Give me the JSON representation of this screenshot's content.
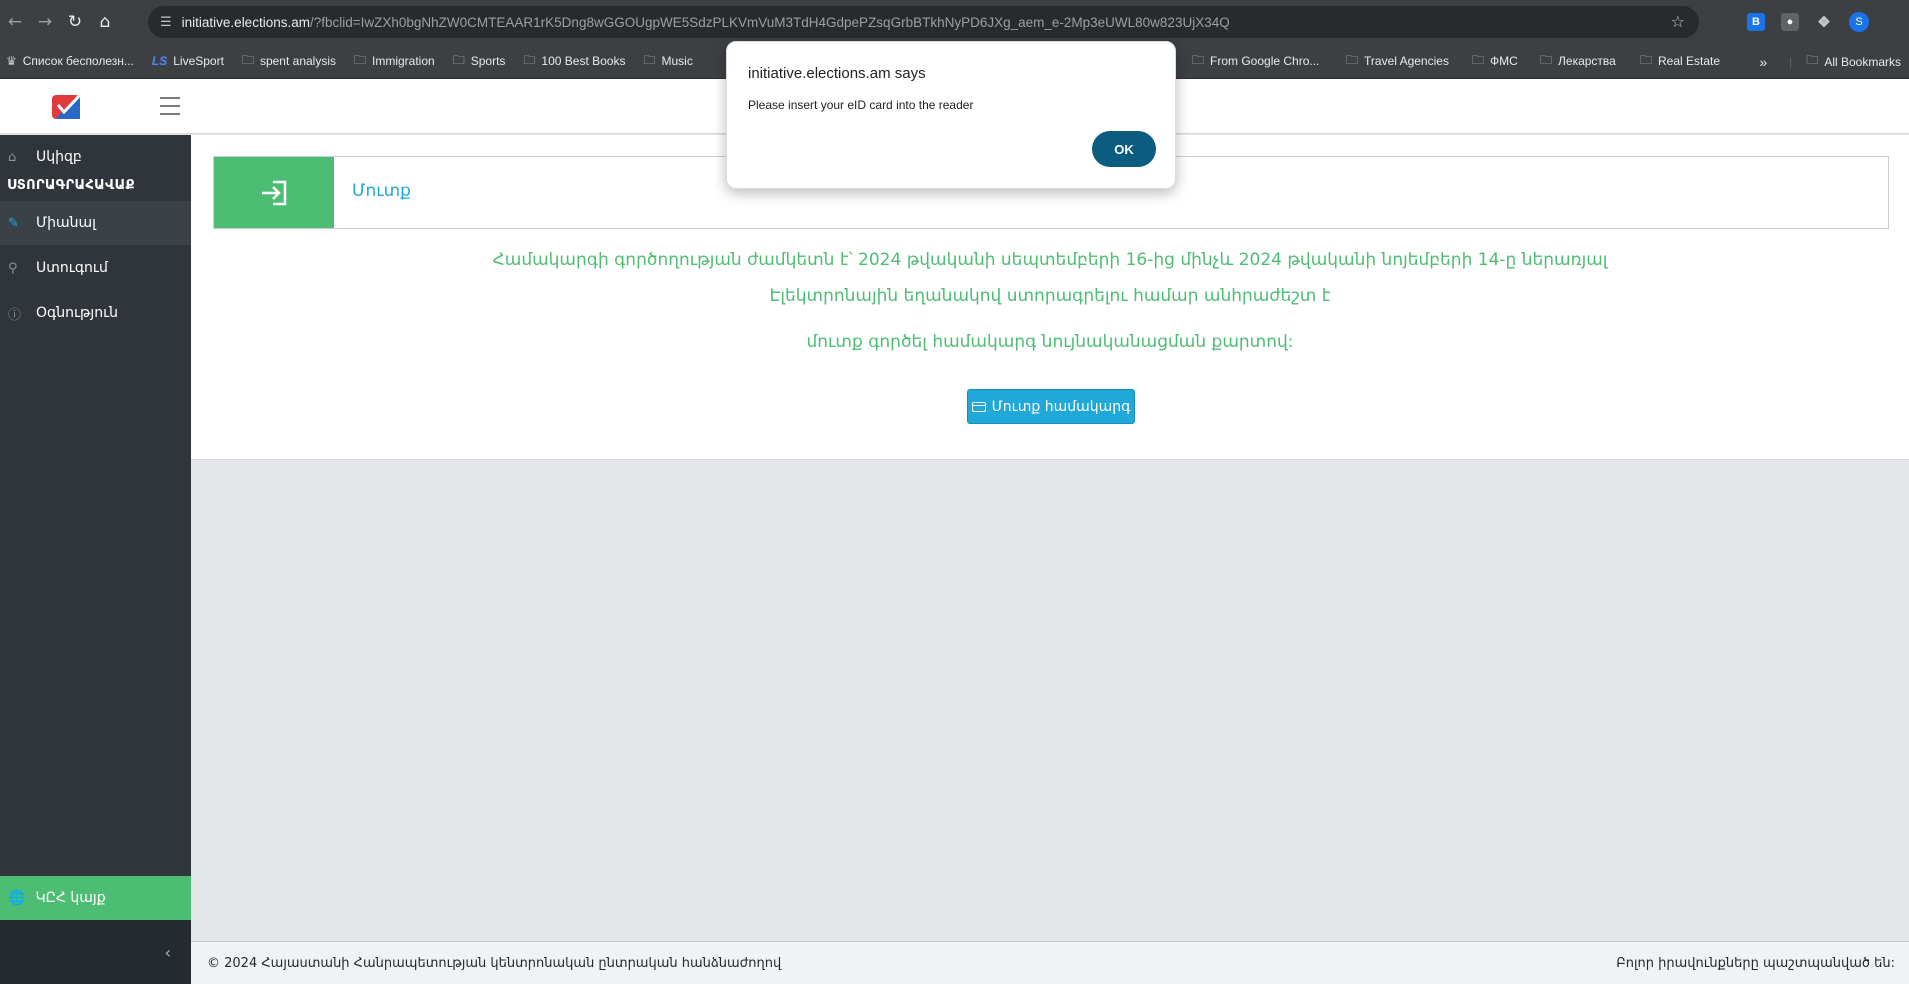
{
  "browser": {
    "url_host": "initiative.elections.am",
    "url_rest": "/?fbclid=IwZXh0bgNhZW0CMTEAAR1rK5Dng8wGGOUgpWE5SdzPLKVmVuM3TdH4GdpePZsqGrbBTkhNyPD6JXg_aem_e-2Mp3eUWL80w823UjX34Q",
    "profile_initial": "S",
    "ext_b_label": "B",
    "bookmarks": [
      {
        "label": "Список бесполезн...",
        "icon": "site-icon"
      },
      {
        "label": "LiveSport",
        "icon": "livesport-icon"
      },
      {
        "label": "spent analysis",
        "icon": "folder-icon"
      },
      {
        "label": "Immigration",
        "icon": "folder-icon"
      },
      {
        "label": "Sports",
        "icon": "folder-icon"
      },
      {
        "label": "100 Best Books",
        "icon": "folder-icon"
      },
      {
        "label": "Music",
        "icon": "folder-icon"
      }
    ],
    "bookmarks_right": [
      {
        "label": "From Google Chro...",
        "icon": "folder-icon"
      },
      {
        "label": "Travel Agencies",
        "icon": "folder-icon"
      },
      {
        "label": "ФМС",
        "icon": "folder-icon"
      },
      {
        "label": "Лекарства",
        "icon": "folder-icon"
      },
      {
        "label": "Real Estate",
        "icon": "folder-icon"
      }
    ],
    "more_label": "»",
    "all_bookmarks": "All Bookmarks"
  },
  "sidebar": {
    "items": [
      {
        "label": "Սկիզբ",
        "icon": "home-icon"
      },
      {
        "label": "Միանալ",
        "icon": "edit-icon"
      },
      {
        "label": "Ստուգում",
        "icon": "key-icon"
      },
      {
        "label": "Օգնություն",
        "icon": "info-icon"
      }
    ],
    "section_title": "ՍՏՈՐԱԳՐԱՀԱՎԱՔ",
    "bottom_link": "ԿԸՀ կայք"
  },
  "main": {
    "login_card_label": "Մուտք",
    "line1": "Համակարգի գործողության ժամկետն է՝ 2024 թվականի սեպտեմբերի 16-ից մինչև 2024 թվականի նոյեմբերի 14-ը ներառյալ",
    "line2": "Էլեկտրոնային եղանակով ստորագրելու համար անհրաժեշտ է",
    "line3": "մուտք գործել համակարգ նույնականացման քարտով:",
    "login_button": "Մուտք համակարգ"
  },
  "footer": {
    "left": "© 2024 Հայաստանի Հանրապետության կենտրոնական ընտրական հանձնաժողով",
    "right": "Բոլոր իրավունքները պաշտպանված են:"
  },
  "dialog": {
    "title": "initiative.elections.am says",
    "message": "Please insert your eID card into the reader",
    "ok_label": "OK"
  },
  "colors": {
    "green": "#4dbd74",
    "blue": "#20a8d8",
    "sidebar": "#2f353a",
    "dialog_button": "#0b5c7f"
  }
}
